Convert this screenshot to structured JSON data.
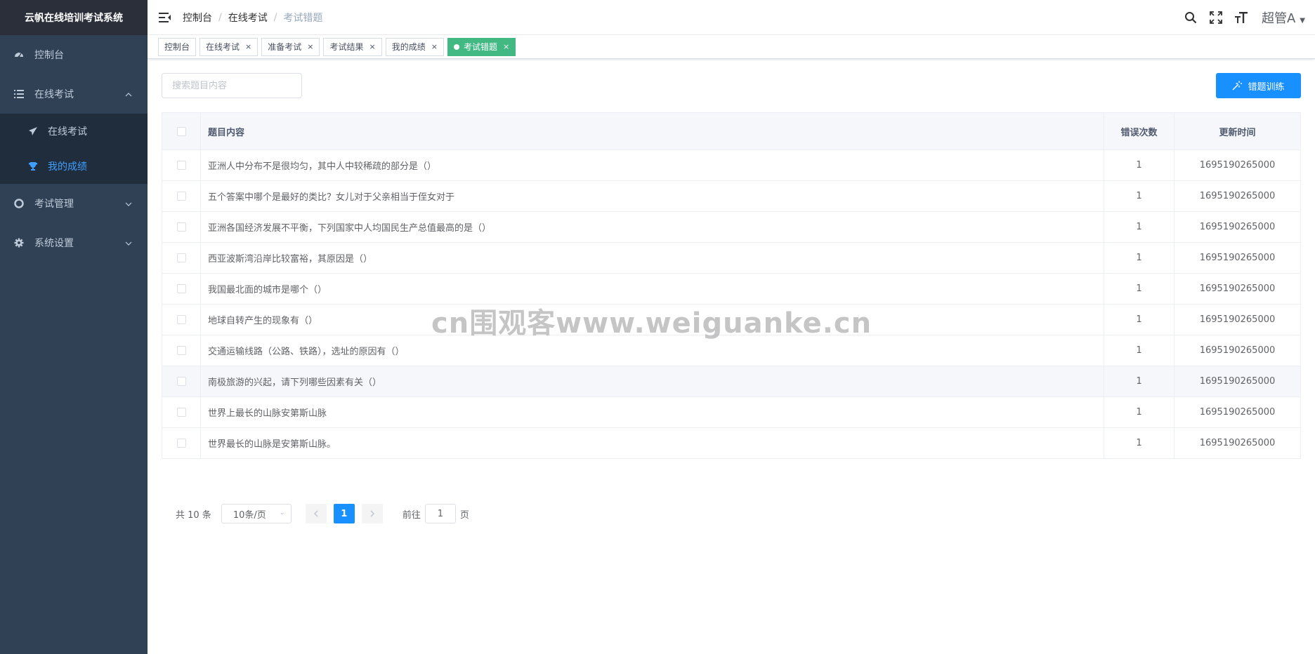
{
  "app": {
    "title": "云帆在线培训考试系统"
  },
  "sidebar": {
    "items": [
      {
        "label": "控制台",
        "icon": "dashboard-icon"
      },
      {
        "label": "在线考试",
        "icon": "list-icon",
        "expanded": true,
        "children": [
          {
            "label": "在线考试",
            "icon": "paper-plane-icon"
          },
          {
            "label": "我的成绩",
            "icon": "trophy-icon",
            "active": true
          }
        ]
      },
      {
        "label": "考试管理",
        "icon": "lifebuoy-icon"
      },
      {
        "label": "系统设置",
        "icon": "gear-icon"
      }
    ]
  },
  "breadcrumb": [
    "控制台",
    "在线考试",
    "考试错题"
  ],
  "user": {
    "name": "超管A"
  },
  "tags": [
    {
      "label": "控制台",
      "closable": false
    },
    {
      "label": "在线考试",
      "closable": true
    },
    {
      "label": "准备考试",
      "closable": true
    },
    {
      "label": "考试结果",
      "closable": true
    },
    {
      "label": "我的成绩",
      "closable": true
    },
    {
      "label": "考试错题",
      "closable": true,
      "active": true
    }
  ],
  "toolbar": {
    "search_placeholder": "搜索题目内容",
    "train_button": "错题训练"
  },
  "table": {
    "headers": {
      "content": "题目内容",
      "errors": "错误次数",
      "updated": "更新时间"
    },
    "rows": [
      {
        "content": "亚洲人中分布不是很均匀，其中人中较稀疏的部分是（）",
        "errors": "1",
        "updated": "1695190265000"
      },
      {
        "content": "五个答案中哪个是最好的类比？女儿对于父亲相当于侄女对于",
        "errors": "1",
        "updated": "1695190265000"
      },
      {
        "content": "亚洲各国经济发展不平衡，下列国家中人均国民生产总值最高的是（）",
        "errors": "1",
        "updated": "1695190265000"
      },
      {
        "content": "西亚波斯湾沿岸比较富裕，其原因是（）",
        "errors": "1",
        "updated": "1695190265000"
      },
      {
        "content": "我国最北面的城市是哪个（）",
        "errors": "1",
        "updated": "1695190265000"
      },
      {
        "content": "地球自转产生的现象有（）",
        "errors": "1",
        "updated": "1695190265000"
      },
      {
        "content": "交通运输线路（公路、铁路），选址的原因有（）",
        "errors": "1",
        "updated": "1695190265000"
      },
      {
        "content": "南极旅游的兴起，请下列哪些因素有关（）",
        "errors": "1",
        "updated": "1695190265000"
      },
      {
        "content": "世界上最长的山脉安第斯山脉",
        "errors": "1",
        "updated": "1695190265000"
      },
      {
        "content": "世界最长的山脉是安第斯山脉。",
        "errors": "1",
        "updated": "1695190265000"
      }
    ]
  },
  "pagination": {
    "total_text": "共 10 条",
    "page_size": "10条/页",
    "current_page": "1",
    "goto_label": "前往",
    "goto_value": "1",
    "page_unit": "页"
  },
  "watermark": "cn围观客www.weiguanke.cn",
  "colors": {
    "sidebar_bg": "#304156",
    "accent": "#1890ff",
    "active_tag": "#42b983",
    "active_menu": "#409eff"
  }
}
